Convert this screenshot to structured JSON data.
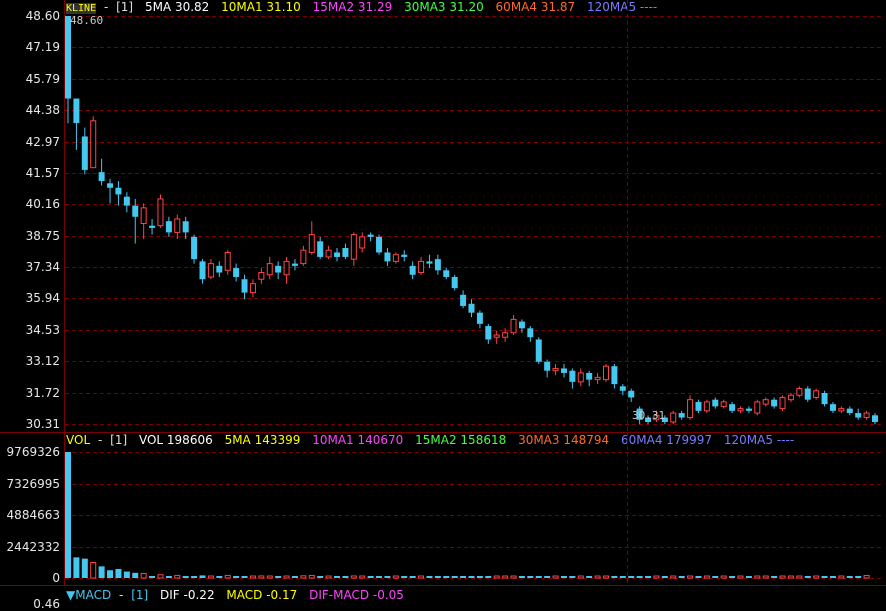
{
  "kline": {
    "legend": {
      "name": "KLINE",
      "sep": "-",
      "period": "[1]",
      "ma5": "5MA 30.82",
      "ma10": "10MA1 31.10",
      "ma15": "15MA2 31.29",
      "ma30": "30MA3 31.20",
      "ma60": "60MA4 31.87",
      "ma120": "120MA5 ----"
    },
    "axis_labels": [
      "48.60",
      "47.19",
      "45.79",
      "44.38",
      "42.97",
      "41.57",
      "40.16",
      "38.75",
      "37.34",
      "35.94",
      "34.53",
      "33.12",
      "31.72",
      "30.31"
    ],
    "max_label": "48.60",
    "min_label": "30.31",
    "colors": {
      "up": "#ff4444",
      "down": "#44c8f0",
      "grid": "#7a0000",
      "ma5": "#ffffff",
      "ma10": "#ffff00",
      "ma15": "#ff44ff",
      "ma30": "#44ff44",
      "ma60": "#ff6a2a",
      "ma120": "#7a7aff",
      "name": "#ffff00"
    }
  },
  "volume": {
    "legend": {
      "name": "VOL",
      "sep": "-",
      "period": "[1]",
      "vol": "VOL 198606",
      "ma5": "5MA 143399",
      "ma10": "10MA1 140670",
      "ma15": "15MA2 158618",
      "ma30": "30MA3 148794",
      "ma60": "60MA4 179997",
      "ma120": "120MA5 ----"
    },
    "axis_labels": [
      "9769326",
      "7326995",
      "4884663",
      "2442332",
      "0"
    ]
  },
  "macd": {
    "legend": {
      "name": "▼MACD",
      "sep": "-",
      "period": "[1]",
      "dif": "DIF -0.22",
      "macd": "MACD -0.17",
      "difmacd": "DIF-MACD -0.05"
    },
    "axis_labels": [
      "0.46"
    ]
  },
  "chart_data": {
    "type": "candlestick",
    "price_range": [
      30.31,
      48.6
    ],
    "volume_range": [
      0,
      9769326
    ],
    "candles": [
      {
        "o": 48.6,
        "c": 44.9,
        "h": 48.6,
        "l": 43.8
      },
      {
        "o": 44.9,
        "c": 43.8,
        "h": 44.6,
        "l": 42.6
      },
      {
        "o": 43.2,
        "c": 41.7,
        "h": 43.6,
        "l": 41.5
      },
      {
        "o": 41.8,
        "c": 43.9,
        "h": 44.1,
        "l": 41.8
      },
      {
        "o": 41.6,
        "c": 41.2,
        "h": 42.2,
        "l": 41.0
      },
      {
        "o": 41.1,
        "c": 40.9,
        "h": 41.3,
        "l": 40.2
      },
      {
        "o": 40.9,
        "c": 40.6,
        "h": 41.2,
        "l": 40.1
      },
      {
        "o": 40.5,
        "c": 40.1,
        "h": 40.7,
        "l": 39.8
      },
      {
        "o": 40.1,
        "c": 39.6,
        "h": 40.4,
        "l": 38.4
      },
      {
        "o": 39.3,
        "c": 40.0,
        "h": 40.2,
        "l": 38.6
      },
      {
        "o": 39.2,
        "c": 39.1,
        "h": 39.5,
        "l": 38.8
      },
      {
        "o": 39.2,
        "c": 40.4,
        "h": 40.6,
        "l": 39.1
      },
      {
        "o": 39.4,
        "c": 38.9,
        "h": 39.6,
        "l": 38.7
      },
      {
        "o": 38.9,
        "c": 39.5,
        "h": 39.7,
        "l": 38.6
      },
      {
        "o": 39.4,
        "c": 38.9,
        "h": 39.6,
        "l": 38.6
      },
      {
        "o": 38.7,
        "c": 37.7,
        "h": 38.8,
        "l": 37.5
      },
      {
        "o": 37.6,
        "c": 36.8,
        "h": 37.7,
        "l": 36.6
      },
      {
        "o": 36.9,
        "c": 37.5,
        "h": 37.7,
        "l": 36.8
      },
      {
        "o": 37.4,
        "c": 37.1,
        "h": 37.6,
        "l": 36.9
      },
      {
        "o": 37.2,
        "c": 38.0,
        "h": 38.1,
        "l": 37.0
      },
      {
        "o": 37.3,
        "c": 36.9,
        "h": 37.5,
        "l": 36.7
      },
      {
        "o": 36.8,
        "c": 36.2,
        "h": 37.0,
        "l": 35.9
      },
      {
        "o": 36.2,
        "c": 36.6,
        "h": 36.8,
        "l": 36.0
      },
      {
        "o": 36.8,
        "c": 37.1,
        "h": 37.3,
        "l": 36.6
      },
      {
        "o": 37.0,
        "c": 37.5,
        "h": 37.8,
        "l": 36.8
      },
      {
        "o": 37.4,
        "c": 37.1,
        "h": 37.6,
        "l": 36.8
      },
      {
        "o": 37.0,
        "c": 37.6,
        "h": 37.8,
        "l": 36.6
      },
      {
        "o": 37.5,
        "c": 37.4,
        "h": 37.7,
        "l": 37.2
      },
      {
        "o": 37.5,
        "c": 38.1,
        "h": 38.3,
        "l": 37.4
      },
      {
        "o": 38.0,
        "c": 38.8,
        "h": 39.4,
        "l": 37.9
      },
      {
        "o": 38.5,
        "c": 37.8,
        "h": 38.7,
        "l": 37.7
      },
      {
        "o": 37.8,
        "c": 38.1,
        "h": 38.3,
        "l": 37.7
      },
      {
        "o": 38.0,
        "c": 37.8,
        "h": 38.2,
        "l": 37.6
      },
      {
        "o": 38.2,
        "c": 37.8,
        "h": 38.4,
        "l": 37.7
      },
      {
        "o": 37.7,
        "c": 38.8,
        "h": 38.9,
        "l": 37.4
      },
      {
        "o": 38.2,
        "c": 38.7,
        "h": 38.9,
        "l": 38.0
      },
      {
        "o": 38.8,
        "c": 38.7,
        "h": 38.9,
        "l": 38.5
      },
      {
        "o": 38.7,
        "c": 38.0,
        "h": 38.8,
        "l": 37.9
      },
      {
        "o": 38.0,
        "c": 37.6,
        "h": 38.2,
        "l": 37.4
      },
      {
        "o": 37.6,
        "c": 37.9,
        "h": 38.0,
        "l": 37.5
      },
      {
        "o": 37.9,
        "c": 37.8,
        "h": 38.1,
        "l": 37.6
      },
      {
        "o": 37.4,
        "c": 37.0,
        "h": 37.6,
        "l": 36.8
      },
      {
        "o": 37.1,
        "c": 37.6,
        "h": 37.8,
        "l": 37.0
      },
      {
        "o": 37.6,
        "c": 37.5,
        "h": 37.9,
        "l": 37.3
      },
      {
        "o": 37.7,
        "c": 37.2,
        "h": 37.9,
        "l": 37.0
      },
      {
        "o": 37.2,
        "c": 36.9,
        "h": 37.3,
        "l": 36.8
      },
      {
        "o": 36.9,
        "c": 36.4,
        "h": 37.0,
        "l": 36.3
      },
      {
        "o": 36.1,
        "c": 35.6,
        "h": 36.3,
        "l": 35.5
      },
      {
        "o": 35.7,
        "c": 35.3,
        "h": 35.9,
        "l": 35.1
      },
      {
        "o": 35.3,
        "c": 34.8,
        "h": 35.4,
        "l": 34.6
      },
      {
        "o": 34.7,
        "c": 34.1,
        "h": 34.8,
        "l": 33.9
      },
      {
        "o": 34.2,
        "c": 34.3,
        "h": 34.5,
        "l": 33.9
      },
      {
        "o": 34.2,
        "c": 34.4,
        "h": 34.6,
        "l": 34.0
      },
      {
        "o": 34.4,
        "c": 35.0,
        "h": 35.2,
        "l": 34.3
      },
      {
        "o": 34.9,
        "c": 34.6,
        "h": 35.0,
        "l": 34.4
      },
      {
        "o": 34.6,
        "c": 34.2,
        "h": 34.7,
        "l": 34.0
      },
      {
        "o": 34.1,
        "c": 33.1,
        "h": 34.2,
        "l": 33.0
      },
      {
        "o": 33.1,
        "c": 32.7,
        "h": 33.2,
        "l": 32.4
      },
      {
        "o": 32.7,
        "c": 32.8,
        "h": 33.0,
        "l": 32.5
      },
      {
        "o": 32.8,
        "c": 32.6,
        "h": 33.0,
        "l": 32.4
      },
      {
        "o": 32.7,
        "c": 32.2,
        "h": 32.8,
        "l": 31.9
      },
      {
        "o": 32.2,
        "c": 32.6,
        "h": 32.8,
        "l": 32.0
      },
      {
        "o": 32.6,
        "c": 32.3,
        "h": 32.7,
        "l": 32.0
      },
      {
        "o": 32.3,
        "c": 32.4,
        "h": 32.6,
        "l": 32.1
      },
      {
        "o": 32.3,
        "c": 32.9,
        "h": 33.0,
        "l": 32.2
      },
      {
        "o": 32.9,
        "c": 32.1,
        "h": 33.0,
        "l": 31.9
      },
      {
        "o": 32.0,
        "c": 31.8,
        "h": 32.1,
        "l": 31.6
      },
      {
        "o": 31.8,
        "c": 31.5,
        "h": 31.9,
        "l": 31.3
      },
      {
        "o": 31.0,
        "c": 30.5,
        "h": 31.1,
        "l": 30.3
      },
      {
        "o": 30.6,
        "c": 30.4,
        "h": 30.7,
        "l": 30.31
      },
      {
        "o": 30.5,
        "c": 30.7,
        "h": 30.9,
        "l": 30.4
      },
      {
        "o": 30.6,
        "c": 30.4,
        "h": 30.7,
        "l": 30.3
      },
      {
        "o": 30.4,
        "c": 30.8,
        "h": 30.9,
        "l": 30.3
      },
      {
        "o": 30.8,
        "c": 30.6,
        "h": 30.9,
        "l": 30.5
      },
      {
        "o": 30.6,
        "c": 31.4,
        "h": 31.6,
        "l": 30.5
      },
      {
        "o": 31.3,
        "c": 30.9,
        "h": 31.4,
        "l": 30.8
      },
      {
        "o": 30.9,
        "c": 31.3,
        "h": 31.4,
        "l": 30.8
      },
      {
        "o": 31.4,
        "c": 31.1,
        "h": 31.5,
        "l": 31.0
      },
      {
        "o": 31.1,
        "c": 31.3,
        "h": 31.4,
        "l": 31.0
      },
      {
        "o": 31.2,
        "c": 30.9,
        "h": 31.3,
        "l": 30.8
      },
      {
        "o": 30.9,
        "c": 31.0,
        "h": 31.1,
        "l": 30.8
      },
      {
        "o": 31.0,
        "c": 30.9,
        "h": 31.1,
        "l": 30.8
      },
      {
        "o": 30.8,
        "c": 31.3,
        "h": 31.4,
        "l": 30.7
      },
      {
        "o": 31.2,
        "c": 31.4,
        "h": 31.5,
        "l": 31.1
      },
      {
        "o": 31.4,
        "c": 31.1,
        "h": 31.5,
        "l": 31.0
      },
      {
        "o": 31.0,
        "c": 31.5,
        "h": 31.6,
        "l": 30.9
      },
      {
        "o": 31.4,
        "c": 31.6,
        "h": 31.7,
        "l": 31.3
      },
      {
        "o": 31.6,
        "c": 31.9,
        "h": 32.0,
        "l": 31.5
      },
      {
        "o": 31.9,
        "c": 31.4,
        "h": 32.0,
        "l": 31.3
      },
      {
        "o": 31.5,
        "c": 31.8,
        "h": 31.9,
        "l": 31.4
      },
      {
        "o": 31.7,
        "c": 31.2,
        "h": 31.8,
        "l": 31.1
      },
      {
        "o": 31.2,
        "c": 30.9,
        "h": 31.3,
        "l": 30.8
      },
      {
        "o": 30.9,
        "c": 31.0,
        "h": 31.1,
        "l": 30.8
      },
      {
        "o": 31.0,
        "c": 30.8,
        "h": 31.1,
        "l": 30.7
      },
      {
        "o": 30.8,
        "c": 30.6,
        "h": 31.0,
        "l": 30.5
      },
      {
        "o": 30.6,
        "c": 30.8,
        "h": 30.9,
        "l": 30.5
      },
      {
        "o": 30.7,
        "c": 30.4,
        "h": 30.8,
        "l": 30.3
      }
    ],
    "volumes": [
      9769326,
      1600000,
      1500000,
      1200000,
      900000,
      600000,
      700000,
      500000,
      400000,
      350000,
      150000,
      250000,
      120000,
      200000,
      130000,
      110000,
      200000,
      120000,
      130000,
      200000,
      150000,
      140000,
      130000,
      160000,
      120000,
      140000,
      110000,
      150000,
      170000,
      200000,
      150000,
      120000,
      100000,
      130000,
      160000,
      110000,
      100000,
      140000,
      120000,
      100000,
      110000,
      130000,
      100000,
      120000,
      110000,
      100000,
      130000,
      140000,
      120000,
      110000,
      130000,
      100000,
      110000,
      120000,
      100000,
      120000,
      130000,
      110000,
      100000,
      120000,
      110000,
      100000,
      120000,
      110000,
      100000,
      120000,
      110000,
      130000,
      100000,
      90000,
      100000,
      110000,
      90000,
      100000,
      120000,
      100000,
      110000,
      90000,
      100000,
      120000,
      100000,
      110000,
      90000,
      100000,
      120000,
      110000,
      100000,
      130000,
      110000,
      100000,
      120000,
      100000,
      110000,
      90000,
      100000,
      198606
    ]
  }
}
